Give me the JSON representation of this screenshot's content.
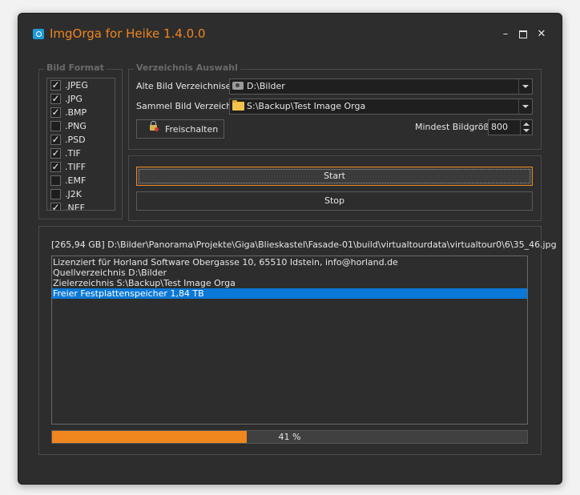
{
  "window": {
    "title": "ImgOrga for Heike 1.4.0.0",
    "controls": {
      "minimize": "–",
      "close": "✕"
    }
  },
  "bild_format": {
    "legend": "Bild Format",
    "items": [
      {
        "label": ".JPEG",
        "checked": true
      },
      {
        "label": ".JPG",
        "checked": true
      },
      {
        "label": ".BMP",
        "checked": true
      },
      {
        "label": ".PNG",
        "checked": false
      },
      {
        "label": ".PSD",
        "checked": true
      },
      {
        "label": ".TIF",
        "checked": true
      },
      {
        "label": ".TIFF",
        "checked": true
      },
      {
        "label": ".EMF",
        "checked": false
      },
      {
        "label": ".J2K",
        "checked": false
      },
      {
        "label": ".NEF",
        "checked": true
      }
    ]
  },
  "verzeichnis": {
    "legend": "Verzeichnis Auswahl",
    "alte_label": "Alte Bild Verzeichnise",
    "alte_value": "D:\\Bilder",
    "alte_icon": "drive-icon",
    "sammel_label": "Sammel Bild Verzeichnis",
    "sammel_value": "S:\\Backup\\Test Image Orga",
    "sammel_icon": "folder-icon",
    "freischalten_label": "Freischalten",
    "freischalten_icon": "lock-icon",
    "mindest_label": "Mindest Bildgröße",
    "mindest_value": "800"
  },
  "actions": {
    "start_label": "Start",
    "stop_label": "Stop"
  },
  "status": {
    "current_path": "[265,94 GB] D:\\Bilder\\Panorama\\Projekte\\Giga\\Blieskastel\\Fasade-01\\build\\virtualtourdata\\virtualtour0\\6\\35_46.jpg",
    "log": [
      "Lizenziert für Horland Software Obergasse 10, 65510 Idstein, info@horland.de",
      "Quellverzeichnis D:\\Bilder",
      "Zielerzeichnis S:\\Backup\\Test Image Orga",
      "Freier Festplattenspeicher 1,84 TB"
    ],
    "selected_log_index": 3,
    "progress_percent": 41,
    "progress_text": "41 %"
  },
  "colors": {
    "accent": "#f0861e",
    "selection": "#0a78d7",
    "background": "#2d2d2d"
  }
}
